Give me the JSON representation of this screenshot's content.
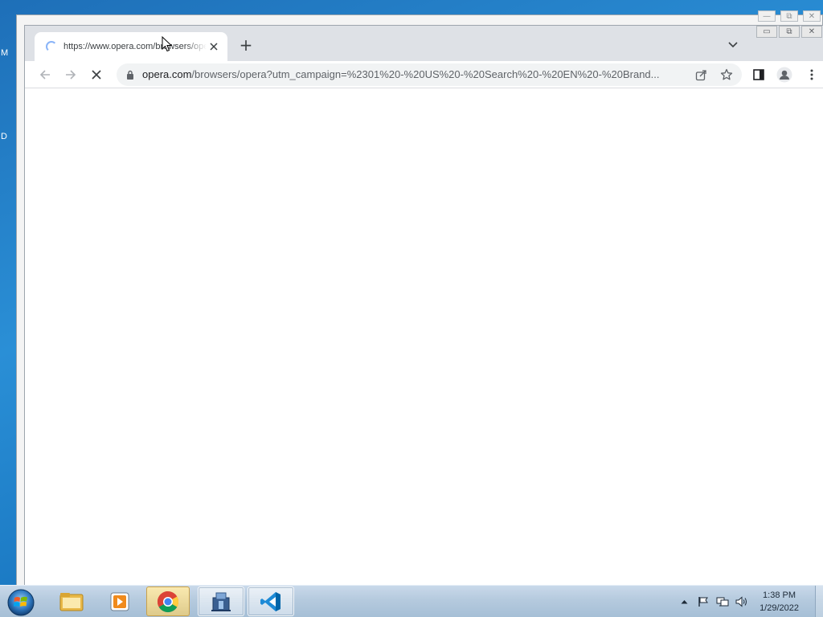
{
  "desktop": {
    "left_labels": [
      "M",
      "D"
    ]
  },
  "browser": {
    "tab": {
      "title": "https://www.opera.com/browsers/opera"
    },
    "new_tab_label": "+",
    "address": {
      "host": "opera.com",
      "path": "/browsers/opera?utm_campaign=%2301%20-%20US%20-%20Search%20-%20EN%20-%20Brand..."
    },
    "window_controls": {
      "minimize": "▭",
      "restore": "⧉",
      "close": "✕"
    }
  },
  "background_window": {
    "window_controls": {
      "minimize": "—",
      "restore": "⧉",
      "close": "✕"
    }
  },
  "taskbar": {
    "apps": [
      {
        "name": "Windows Explorer",
        "icon": "folder-icon"
      },
      {
        "name": "Windows Media Player",
        "icon": "media-player-icon"
      },
      {
        "name": "Google Chrome",
        "icon": "chrome-icon",
        "active": true
      },
      {
        "name": "Installer",
        "icon": "installer-icon"
      },
      {
        "name": "Visual Studio Code",
        "icon": "vscode-icon"
      }
    ],
    "clock": {
      "time": "1:38 PM",
      "date": "1/29/2022"
    }
  }
}
